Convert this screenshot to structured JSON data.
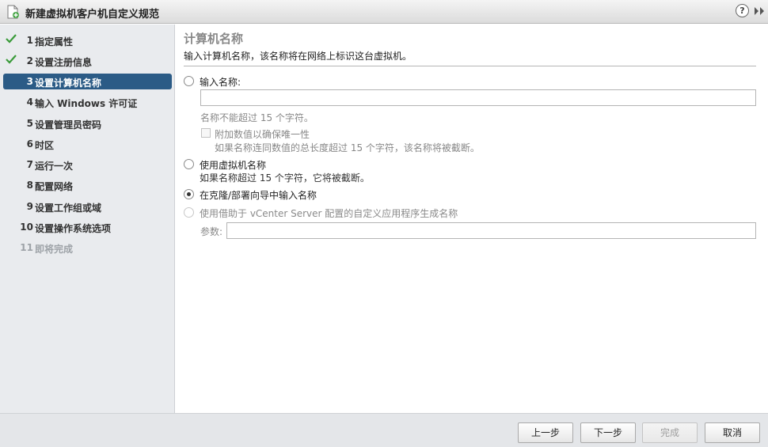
{
  "window": {
    "title": "新建虚拟机客户机自定义规范",
    "help_glyph": "?"
  },
  "steps": [
    {
      "num": "1",
      "label": "指定属性",
      "status": "completed"
    },
    {
      "num": "2",
      "label": "设置注册信息",
      "status": "completed"
    },
    {
      "num": "3",
      "label": "设置计算机名称",
      "status": "active"
    },
    {
      "num": "4",
      "label": "输入 Windows 许可证",
      "status": "pending"
    },
    {
      "num": "5",
      "label": "设置管理员密码",
      "status": "pending"
    },
    {
      "num": "6",
      "label": "时区",
      "status": "pending"
    },
    {
      "num": "7",
      "label": "运行一次",
      "status": "pending"
    },
    {
      "num": "8",
      "label": "配置网络",
      "status": "pending"
    },
    {
      "num": "9",
      "label": "设置工作组或域",
      "status": "pending"
    },
    {
      "num": "10",
      "label": "设置操作系统选项",
      "status": "pending"
    },
    {
      "num": "11",
      "label": "即将完成",
      "status": "disabled"
    }
  ],
  "main": {
    "title": "计算机名称",
    "description": "输入计算机名称，该名称将在网络上标识这台虚拟机。",
    "option_enter_name": {
      "label": "输入名称:",
      "value": "",
      "hint": "名称不能超过 15 个字符。",
      "append_label": "附加数值以确保唯一性",
      "append_hint": "如果名称连同数值的总长度超过 15 个字符，该名称将被截断。"
    },
    "option_use_vm_name": {
      "label": "使用虚拟机名称",
      "hint": "如果名称超过 15 个字符，它将被截断。"
    },
    "option_clone_wizard": {
      "label": "在克隆/部署向导中输入名称",
      "selected": true
    },
    "option_vcenter_app": {
      "label": "使用借助于 vCenter Server 配置的自定义应用程序生成名称",
      "param_label": "参数:",
      "param_value": ""
    }
  },
  "footer": {
    "back": "上一步",
    "next": "下一步",
    "finish": "完成",
    "cancel": "取消"
  },
  "colors": {
    "check": "#3a9b3a",
    "active_step_bg": "#2b5b86",
    "sidebar_bg": "#e9ebee"
  }
}
